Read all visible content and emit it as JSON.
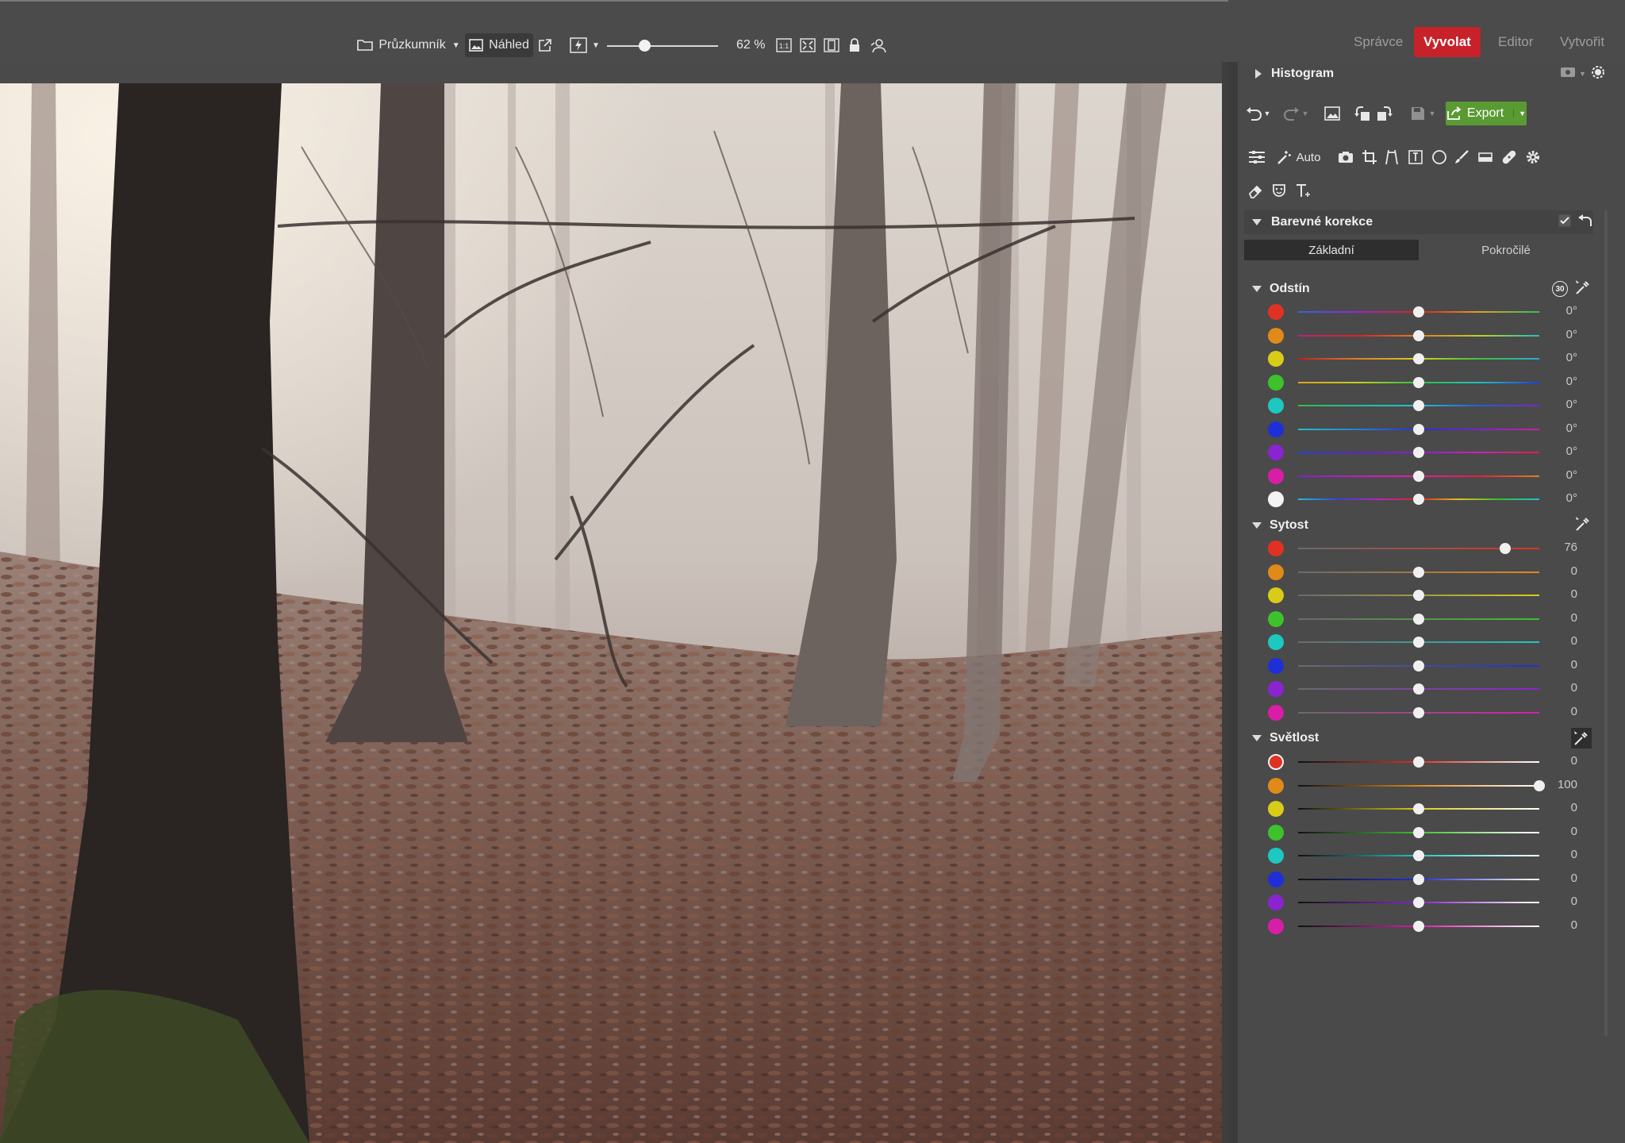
{
  "toolbar": {
    "browser_label": "Průzkumník",
    "preview_label": "Náhled",
    "zoom_value": "62 %",
    "zoom_fraction": 0.34
  },
  "modes": [
    {
      "label": "Správce",
      "active": false
    },
    {
      "label": "Vyvolat",
      "active": true
    },
    {
      "label": "Editor",
      "active": false
    },
    {
      "label": "Vytvořit",
      "active": false
    }
  ],
  "panel": {
    "histogram_title": "Histogram",
    "export_label": "Export",
    "auto_label": "Auto",
    "section_title": "Barevné korekce",
    "tabs": [
      {
        "label": "Základní",
        "active": true
      },
      {
        "label": "Pokročilé",
        "active": false
      }
    ]
  },
  "accent_colors": {
    "mode_active": "#c7212a",
    "export": "#5a9a33"
  },
  "groups": {
    "hue": {
      "title": "Odstín",
      "badge": "30",
      "rows": [
        {
          "color": "#e03222",
          "value": "0°",
          "level": 0.5
        },
        {
          "color": "#e08a1a",
          "value": "0°",
          "level": 0.5
        },
        {
          "color": "#d8cc18",
          "value": "0°",
          "level": 0.5
        },
        {
          "color": "#3ec22c",
          "value": "0°",
          "level": 0.5
        },
        {
          "color": "#1ec8c0",
          "value": "0°",
          "level": 0.5
        },
        {
          "color": "#1e2fd8",
          "value": "0°",
          "level": 0.5
        },
        {
          "color": "#8a24d0",
          "value": "0°",
          "level": 0.5
        },
        {
          "color": "#d81ea8",
          "value": "0°",
          "level": 0.5
        },
        {
          "color": "#f4f4f4",
          "value": "0°",
          "level": 0.5
        }
      ]
    },
    "saturation": {
      "title": "Sytost",
      "rows": [
        {
          "color": "#e03222",
          "value": "76",
          "level": 0.86
        },
        {
          "color": "#e08a1a",
          "value": "0",
          "level": 0.5
        },
        {
          "color": "#d8cc18",
          "value": "0",
          "level": 0.5
        },
        {
          "color": "#3ec22c",
          "value": "0",
          "level": 0.5
        },
        {
          "color": "#1ec8c0",
          "value": "0",
          "level": 0.5
        },
        {
          "color": "#1e2fd8",
          "value": "0",
          "level": 0.5
        },
        {
          "color": "#8a24d0",
          "value": "0",
          "level": 0.5
        },
        {
          "color": "#d81ea8",
          "value": "0",
          "level": 0.5
        }
      ]
    },
    "lightness": {
      "title": "Světlost",
      "rows": [
        {
          "color": "#e03222",
          "value": "0",
          "level": 0.5
        },
        {
          "color": "#e08a1a",
          "value": "100",
          "level": 1.0
        },
        {
          "color": "#d8cc18",
          "value": "0",
          "level": 0.5
        },
        {
          "color": "#3ec22c",
          "value": "0",
          "level": 0.5
        },
        {
          "color": "#1ec8c0",
          "value": "0",
          "level": 0.5
        },
        {
          "color": "#1e2fd8",
          "value": "0",
          "level": 0.5
        },
        {
          "color": "#8a24d0",
          "value": "0",
          "level": 0.5
        },
        {
          "color": "#d81ea8",
          "value": "0",
          "level": 0.5
        }
      ]
    }
  }
}
